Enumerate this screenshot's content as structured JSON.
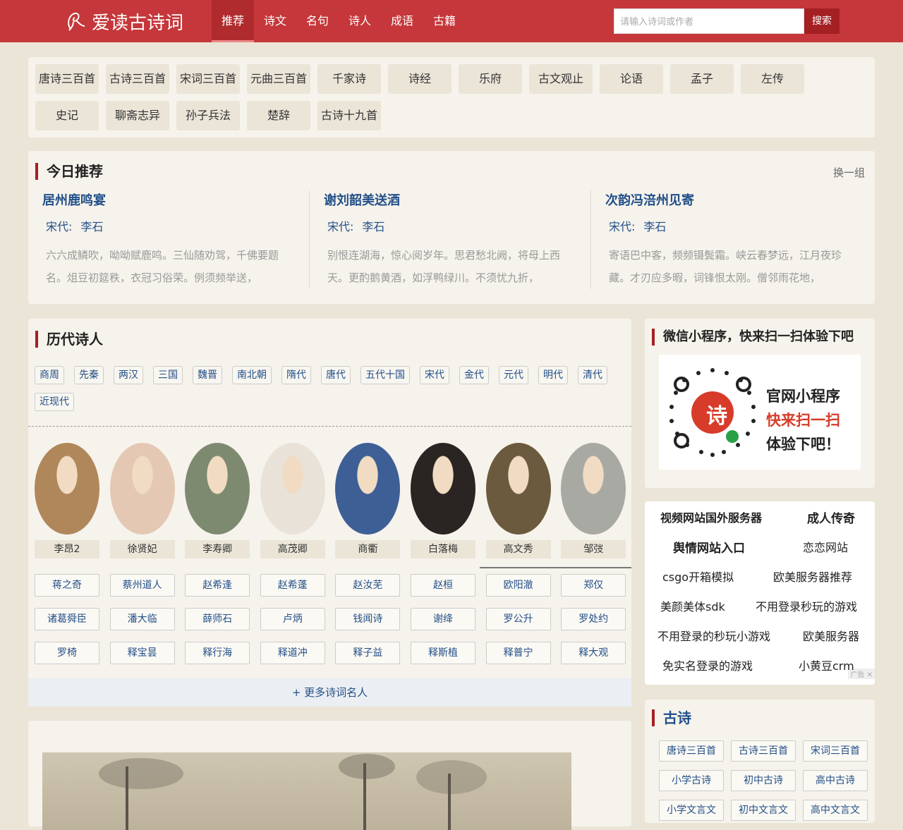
{
  "header": {
    "logo_text": "爱读古诗词",
    "nav": [
      "推荐",
      "诗文",
      "名句",
      "诗人",
      "成语",
      "古籍"
    ],
    "active_nav": "推荐",
    "search_placeholder": "请输入诗词或作者",
    "search_button": "搜索"
  },
  "categories": [
    "唐诗三百首",
    "古诗三百首",
    "宋词三百首",
    "元曲三百首",
    "千家诗",
    "诗经",
    "乐府",
    "古文观止",
    "论语",
    "孟子",
    "左传",
    "史记",
    "聊斋志异",
    "孙子兵法",
    "楚辞",
    "古诗十九首"
  ],
  "today": {
    "title": "今日推荐",
    "swap": "换一组",
    "items": [
      {
        "title": "居州鹿鸣宴",
        "dynasty": "宋代:",
        "author": "李石",
        "content": "六六成鳞吹，呦呦赋鹿鸣。三仙随劝驾，千佛要题名。俎豆初筵秩，衣冠习俗荣。例须频举送，"
      },
      {
        "title": "谢刘韶美送酒",
        "dynasty": "宋代:",
        "author": "李石",
        "content": "别恨连湖海，惊心阅岁年。思君愁北阙，将母上西天。更酌鹅黄酒，如浮鸭绿川。不须忧九折，"
      },
      {
        "title": "次韵冯涪州见寄",
        "dynasty": "宋代:",
        "author": "李石",
        "content": "寄语巴中客，频频镊鬓霜。峡云春梦远，江月夜珍藏。才刃应多暇，词锋恨太刚。僧邻雨花地，"
      }
    ]
  },
  "poets": {
    "title": "历代诗人",
    "eras": [
      "商周",
      "先秦",
      "两汉",
      "三国",
      "魏晋",
      "南北朝",
      "隋代",
      "唐代",
      "五代十国",
      "宋代",
      "金代",
      "元代",
      "明代",
      "清代",
      "近现代"
    ],
    "featured": [
      {
        "name": "李昂2",
        "color": "#b0875a"
      },
      {
        "name": "徐贤妃",
        "color": "#e4c8b4"
      },
      {
        "name": "李寿卿",
        "color": "#7e8a70"
      },
      {
        "name": "高茂卿",
        "color": "#e8e2d8"
      },
      {
        "name": "商衢",
        "color": "#3e5f95"
      },
      {
        "name": "白落梅",
        "color": "#2a2522"
      },
      {
        "name": "高文秀",
        "color": "#6b5a3d"
      },
      {
        "name": "邹弢",
        "color": "#a9a9a4"
      }
    ],
    "names": [
      "蒋之奇",
      "蔡州道人",
      "赵希逢",
      "赵希蓬",
      "赵汝芜",
      "赵桓",
      "欧阳澈",
      "郑仅",
      "诸葛舜臣",
      "潘大临",
      "薛师石",
      "卢炳",
      "钱闻诗",
      "谢绛",
      "罗公升",
      "罗处约",
      "罗椅",
      "释宝昙",
      "释行海",
      "释道冲",
      "释子益",
      "释斯植",
      "释普宁",
      "释大观"
    ],
    "more": "+ 更多诗词名人"
  },
  "wechat": {
    "title": "微信小程序，快来扫一扫体验下吧",
    "qr_center": "诗",
    "line1": "官网小程序",
    "line2": "快来扫一扫",
    "line3": "体验下吧！"
  },
  "ads": {
    "rows": [
      [
        "视频网站国外服务器",
        "成人传奇"
      ],
      [
        "舆情网站入口",
        "恋恋网站"
      ],
      [
        "csgo开箱模拟",
        "欧美服务器推荐"
      ],
      [
        "美颜美体sdk",
        "不用登录秒玩的游戏"
      ],
      [
        "不用登录的秒玩小游戏",
        "欧美服务器"
      ],
      [
        "免实名登录的游戏",
        "小黄豆crm"
      ]
    ],
    "tag": "广告 ✕"
  },
  "gushi": {
    "title": "古诗",
    "items": [
      "唐诗三百首",
      "古诗三百首",
      "宋词三百首",
      "小学古诗",
      "初中古诗",
      "高中古诗",
      "小学文言文",
      "初中文言文",
      "高中文言文"
    ]
  }
}
